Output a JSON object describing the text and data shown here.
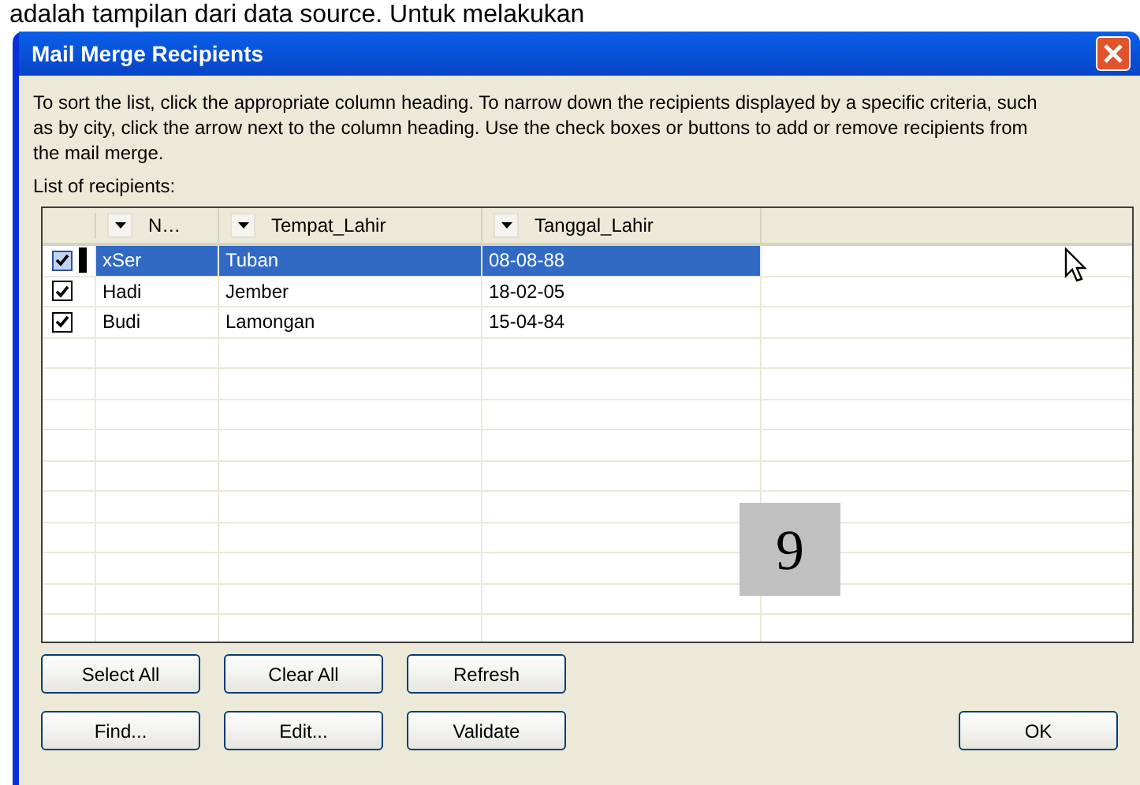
{
  "document_text": "adalah tampilan dari data source. Untuk melakukan",
  "window": {
    "title": "Mail Merge Recipients"
  },
  "instructions": "To sort the list, click the appropriate column heading.  To narrow down the recipients displayed by a specific criteria, such as by city, click the arrow next to the column heading.  Use the check boxes or buttons to add or remove recipients from the mail merge.",
  "list_label": "List of recipients:",
  "table": {
    "columns": [
      "N…",
      "Tempat_Lahir",
      "Tanggal_Lahir"
    ],
    "rows": [
      {
        "checked": true,
        "selected": true,
        "cells": [
          "xSer",
          "Tuban",
          "08-08-88"
        ]
      },
      {
        "checked": true,
        "selected": false,
        "cells": [
          "Hadi",
          "Jember",
          "18-02-05"
        ]
      },
      {
        "checked": true,
        "selected": false,
        "cells": [
          "Budi",
          "Lamongan",
          "15-04-84"
        ]
      }
    ]
  },
  "buttons": [
    {
      "label": "Select All",
      "kind": "action"
    },
    {
      "label": "Clear All",
      "kind": "action"
    },
    {
      "label": "Refresh",
      "kind": "action"
    },
    {
      "label": "Find...",
      "kind": "action"
    },
    {
      "label": "Edit...",
      "kind": "action"
    },
    {
      "label": "Validate",
      "kind": "action"
    },
    {
      "label": "OK",
      "kind": "default"
    }
  ],
  "page_number": "9"
}
